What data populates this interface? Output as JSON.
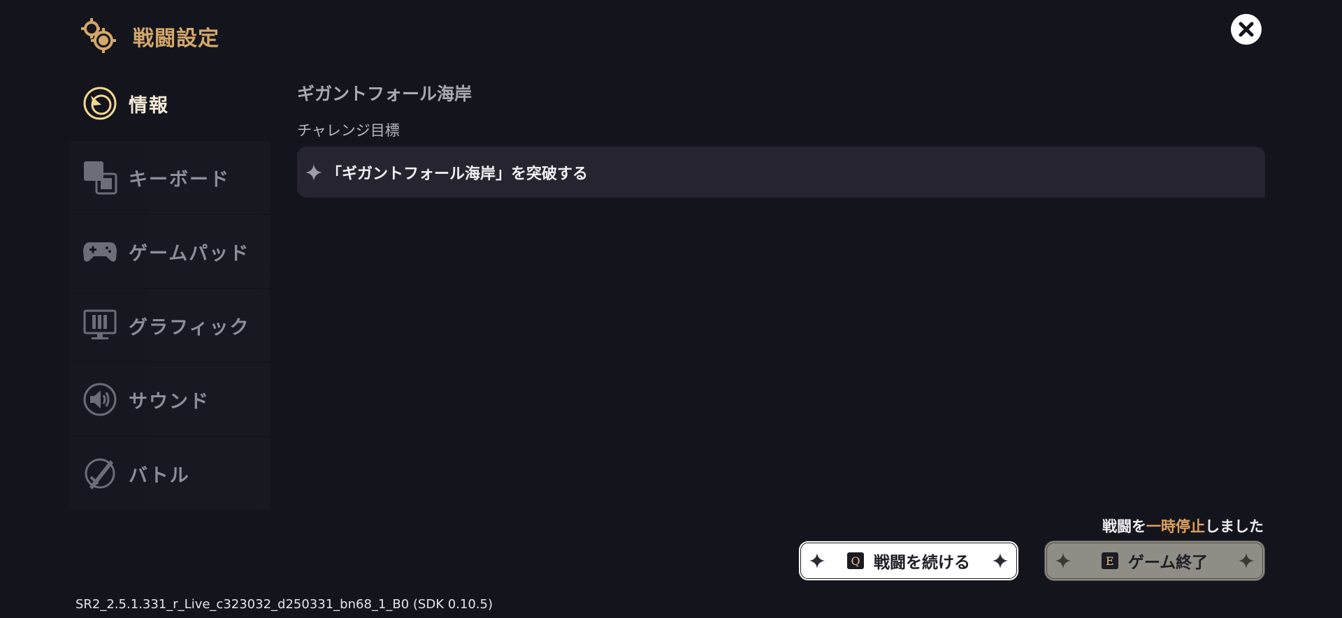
{
  "header": {
    "title": "戦闘設定",
    "icon": "gears-icon",
    "accent_color": "#d4a86a"
  },
  "close": {
    "icon": "close-icon"
  },
  "sidebar": {
    "items": [
      {
        "label": "情報",
        "icon": "info-icon",
        "active": true
      },
      {
        "label": "キーボード",
        "icon": "keyboard-icon",
        "active": false
      },
      {
        "label": "ゲームパッド",
        "icon": "gamepad-icon",
        "active": false
      },
      {
        "label": "グラフィック",
        "icon": "graphics-icon",
        "active": false
      },
      {
        "label": "サウンド",
        "icon": "sound-icon",
        "active": false
      },
      {
        "label": "バトル",
        "icon": "battle-icon",
        "active": false
      }
    ]
  },
  "content": {
    "stage_title": "ギガントフォール海岸",
    "section_label": "チャレンジ目標",
    "objective": {
      "text": "「ギガントフォール海岸」を突破する",
      "icon": "sparkle-icon"
    }
  },
  "status": {
    "paused_prefix": "戦闘を",
    "paused_highlight": "一時停止",
    "paused_suffix": "しました",
    "highlight_color": "#e0a15c"
  },
  "buttons": {
    "continue": {
      "key": "Q",
      "label": "戦闘を続ける"
    },
    "quit": {
      "key": "E",
      "label": "ゲーム終了"
    }
  },
  "version": "SR2_2.5.1.331_r_Live_c323032_d250331_bn68_1_B0 (SDK 0.10.5)"
}
